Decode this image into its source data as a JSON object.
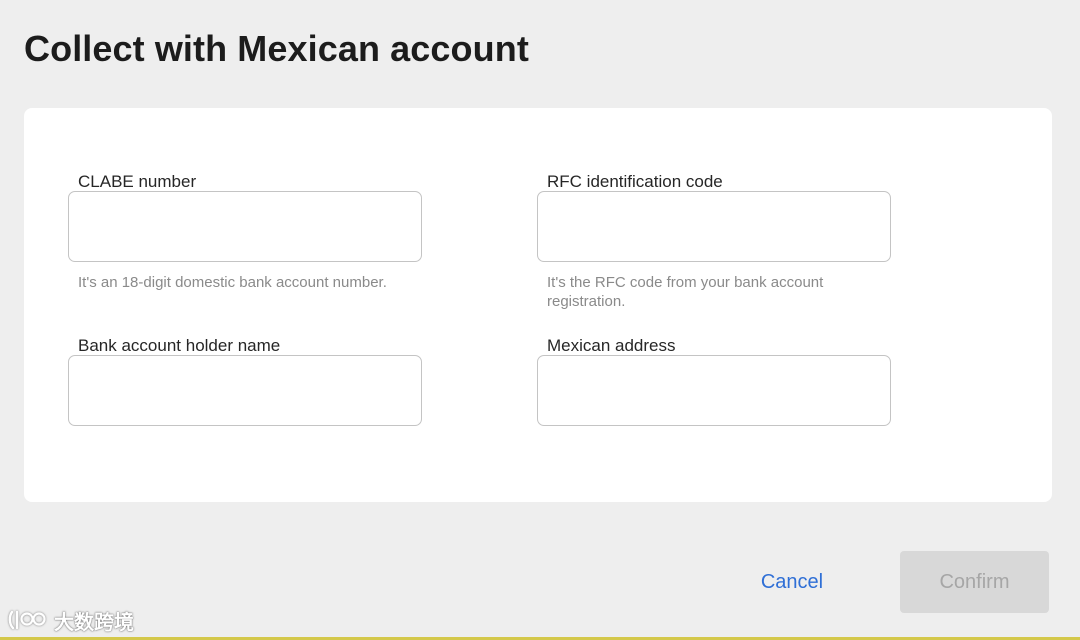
{
  "page": {
    "title": "Collect with Mexican account"
  },
  "form": {
    "clabe": {
      "label": "CLABE number",
      "value": "",
      "help": "It's an 18-digit domestic bank account number."
    },
    "rfc": {
      "label": "RFC identification code",
      "value": "",
      "help": "It's the RFC code from your bank account registration."
    },
    "holder_name": {
      "label": "Bank account holder name",
      "value": ""
    },
    "address": {
      "label": "Mexican address",
      "value": ""
    }
  },
  "actions": {
    "cancel_label": "Cancel",
    "confirm_label": "Confirm",
    "confirm_state": "disabled"
  },
  "watermark": {
    "text": "大数跨境",
    "icon": "brand-logo-icon"
  },
  "colors": {
    "background": "#eeeeee",
    "card": "#ffffff",
    "link": "#2f6fd6",
    "disabled_button_bg": "#d8d8d8",
    "disabled_button_text": "#a6a6a6",
    "help_text": "#8a8a8a"
  }
}
